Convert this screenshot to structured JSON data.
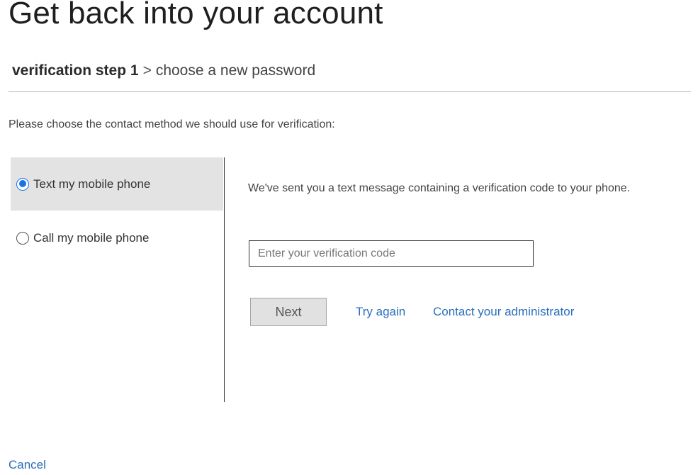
{
  "header": {
    "title": "Get back into your account"
  },
  "breadcrumb": {
    "current_step": "verification step 1",
    "separator": ">",
    "next_step": "choose a new password"
  },
  "instruction": "Please choose the contact method we should use for verification:",
  "methods": [
    {
      "label": "Text my mobile phone",
      "selected": true
    },
    {
      "label": "Call my mobile phone",
      "selected": false
    }
  ],
  "detail": {
    "message": "We've sent you a text message containing a verification code to your phone.",
    "code_input": {
      "value": "",
      "placeholder": "Enter your verification code"
    },
    "next_label": "Next",
    "try_again_label": "Try again",
    "contact_admin_label": "Contact your administrator"
  },
  "footer": {
    "cancel_label": "Cancel"
  },
  "colors": {
    "link": "#2a6ebb",
    "radio_accent": "#1a73e8",
    "selected_method_bg": "#e3e3e3"
  }
}
